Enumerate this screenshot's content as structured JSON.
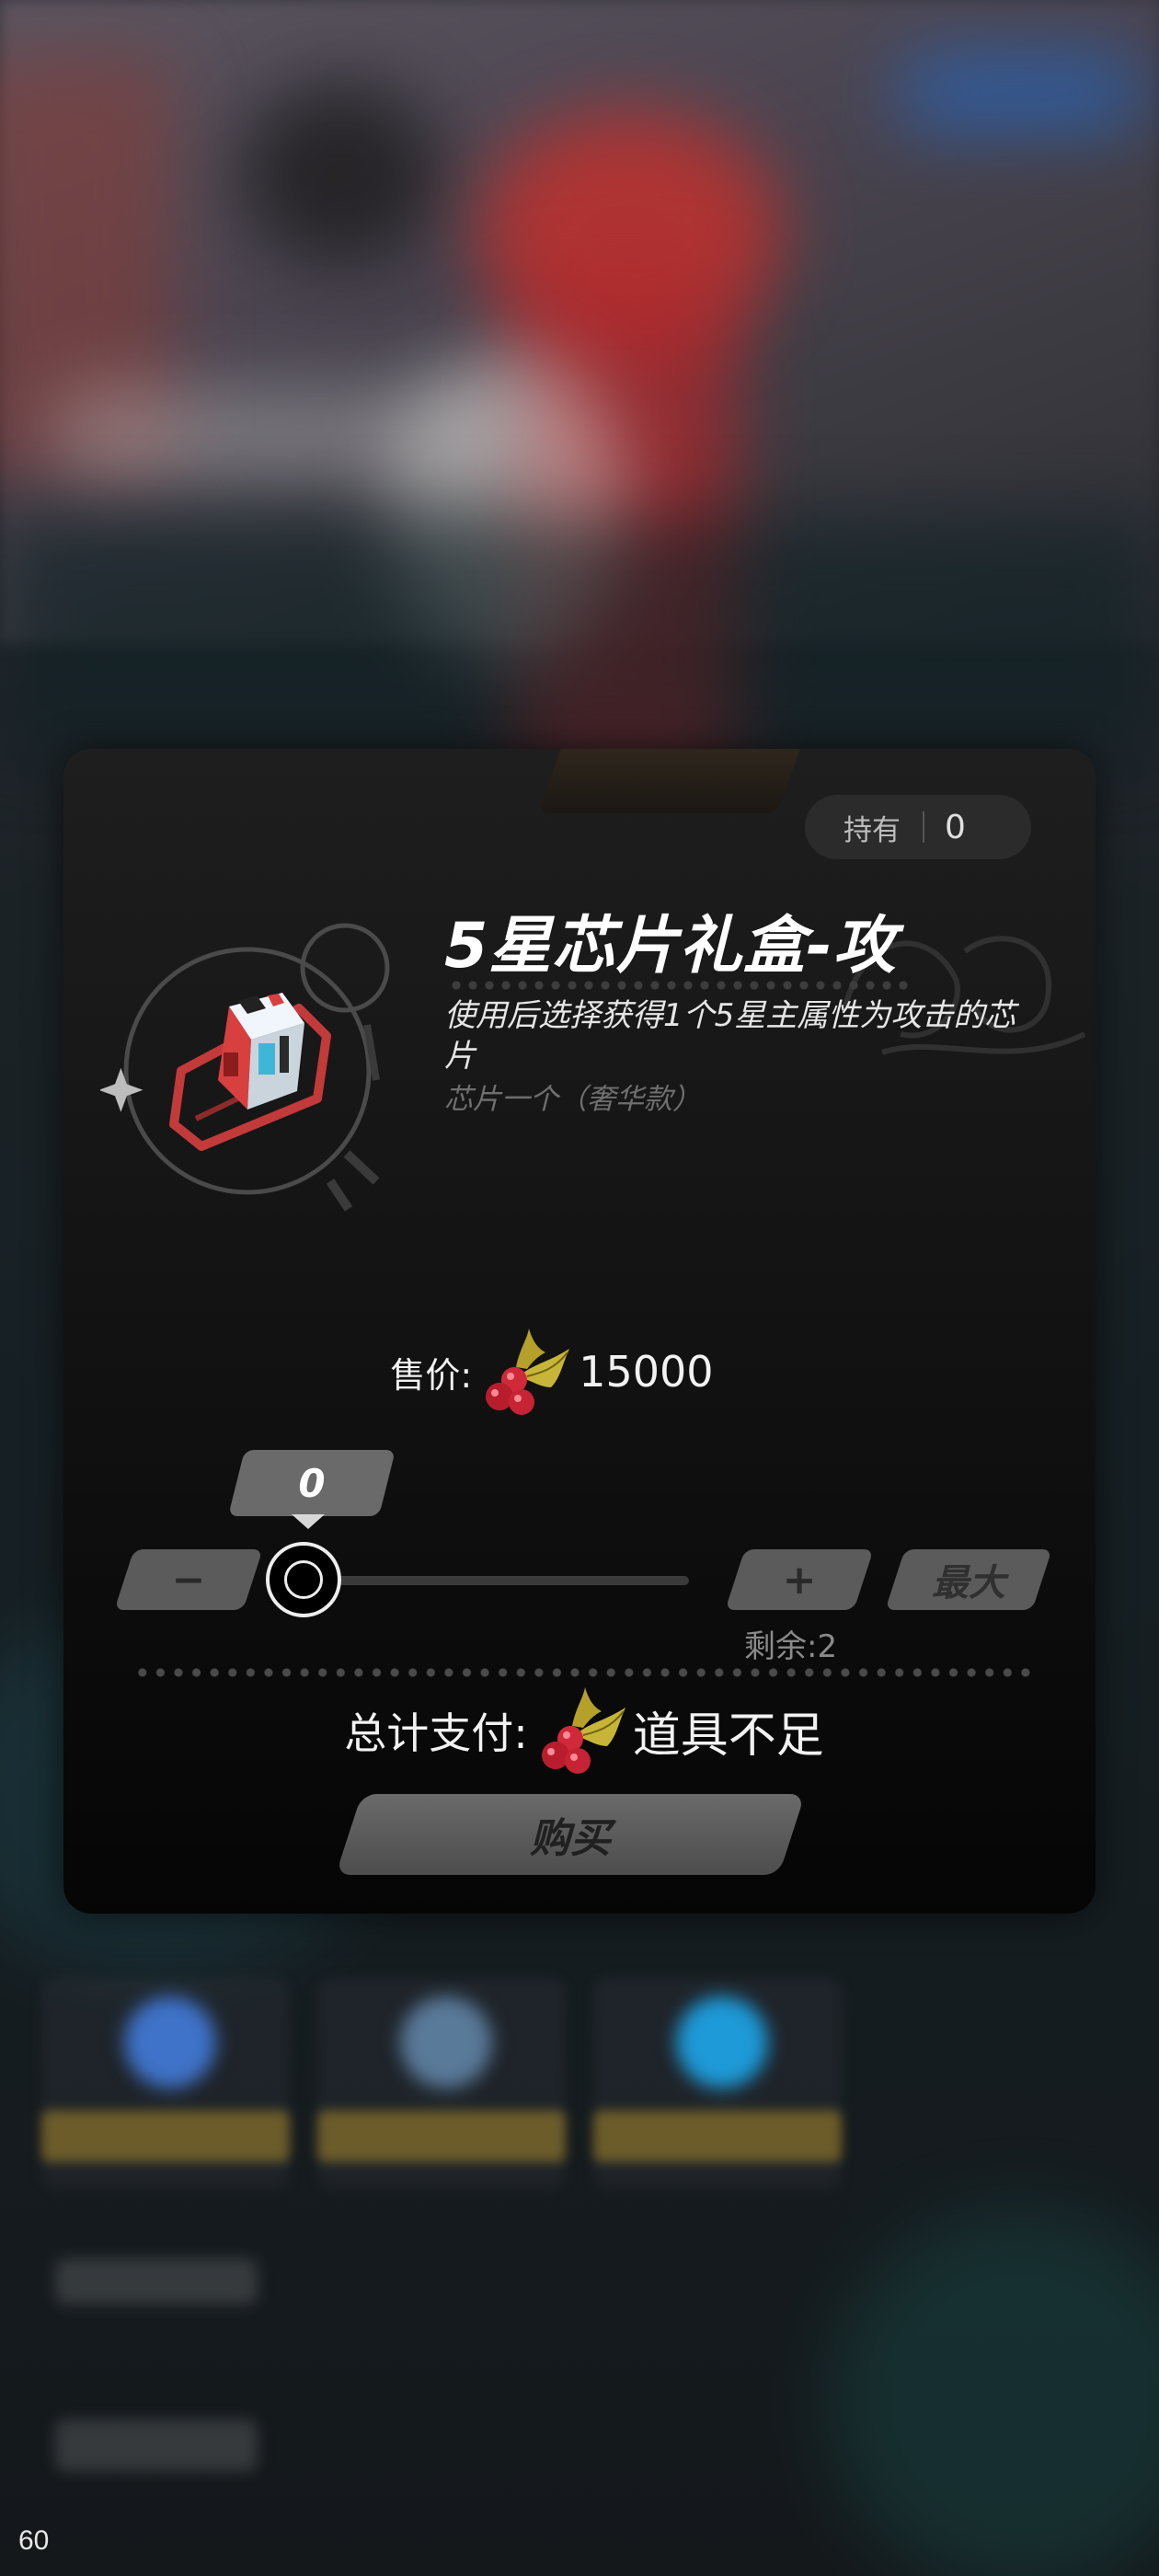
{
  "hud": {
    "fps": "60"
  },
  "dialog": {
    "owned": {
      "label": "持有",
      "value": "0"
    },
    "item": {
      "title": "5星芯片礼盒-攻",
      "description": "使用后选择获得1个5星主属性为攻击的芯片",
      "subtitle": "芯片一个（奢华款）",
      "icon": "gift-box-icon"
    },
    "price": {
      "label": "售价:",
      "currency_icon": "holly-berry-icon",
      "value": "15000"
    },
    "quantity": {
      "value": "0",
      "minus_label": "−",
      "plus_label": "+",
      "max_label": "最大",
      "remaining_label": "剩余:2",
      "slider_fraction": 0
    },
    "total": {
      "label": "总计支付:",
      "currency_icon": "holly-berry-icon",
      "value": "道具不足"
    },
    "buy_label": "购买"
  }
}
